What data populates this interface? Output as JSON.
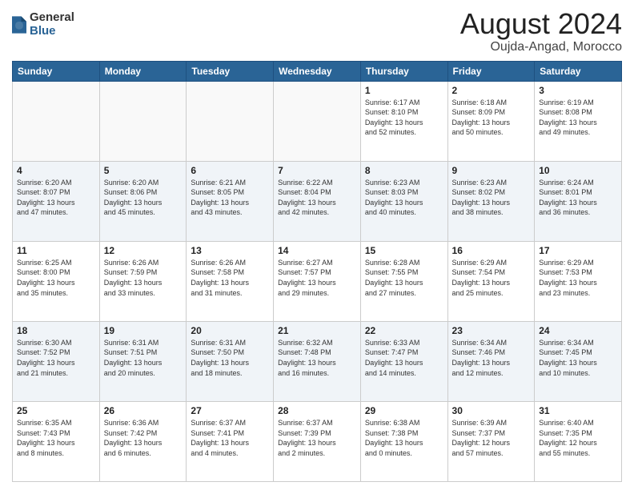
{
  "logo": {
    "general": "General",
    "blue": "Blue"
  },
  "title": "August 2024",
  "location": "Oujda-Angad, Morocco",
  "weekdays": [
    "Sunday",
    "Monday",
    "Tuesday",
    "Wednesday",
    "Thursday",
    "Friday",
    "Saturday"
  ],
  "weeks": [
    [
      {
        "day": "",
        "detail": ""
      },
      {
        "day": "",
        "detail": ""
      },
      {
        "day": "",
        "detail": ""
      },
      {
        "day": "",
        "detail": ""
      },
      {
        "day": "1",
        "detail": "Sunrise: 6:17 AM\nSunset: 8:10 PM\nDaylight: 13 hours\nand 52 minutes."
      },
      {
        "day": "2",
        "detail": "Sunrise: 6:18 AM\nSunset: 8:09 PM\nDaylight: 13 hours\nand 50 minutes."
      },
      {
        "day": "3",
        "detail": "Sunrise: 6:19 AM\nSunset: 8:08 PM\nDaylight: 13 hours\nand 49 minutes."
      }
    ],
    [
      {
        "day": "4",
        "detail": "Sunrise: 6:20 AM\nSunset: 8:07 PM\nDaylight: 13 hours\nand 47 minutes."
      },
      {
        "day": "5",
        "detail": "Sunrise: 6:20 AM\nSunset: 8:06 PM\nDaylight: 13 hours\nand 45 minutes."
      },
      {
        "day": "6",
        "detail": "Sunrise: 6:21 AM\nSunset: 8:05 PM\nDaylight: 13 hours\nand 43 minutes."
      },
      {
        "day": "7",
        "detail": "Sunrise: 6:22 AM\nSunset: 8:04 PM\nDaylight: 13 hours\nand 42 minutes."
      },
      {
        "day": "8",
        "detail": "Sunrise: 6:23 AM\nSunset: 8:03 PM\nDaylight: 13 hours\nand 40 minutes."
      },
      {
        "day": "9",
        "detail": "Sunrise: 6:23 AM\nSunset: 8:02 PM\nDaylight: 13 hours\nand 38 minutes."
      },
      {
        "day": "10",
        "detail": "Sunrise: 6:24 AM\nSunset: 8:01 PM\nDaylight: 13 hours\nand 36 minutes."
      }
    ],
    [
      {
        "day": "11",
        "detail": "Sunrise: 6:25 AM\nSunset: 8:00 PM\nDaylight: 13 hours\nand 35 minutes."
      },
      {
        "day": "12",
        "detail": "Sunrise: 6:26 AM\nSunset: 7:59 PM\nDaylight: 13 hours\nand 33 minutes."
      },
      {
        "day": "13",
        "detail": "Sunrise: 6:26 AM\nSunset: 7:58 PM\nDaylight: 13 hours\nand 31 minutes."
      },
      {
        "day": "14",
        "detail": "Sunrise: 6:27 AM\nSunset: 7:57 PM\nDaylight: 13 hours\nand 29 minutes."
      },
      {
        "day": "15",
        "detail": "Sunrise: 6:28 AM\nSunset: 7:55 PM\nDaylight: 13 hours\nand 27 minutes."
      },
      {
        "day": "16",
        "detail": "Sunrise: 6:29 AM\nSunset: 7:54 PM\nDaylight: 13 hours\nand 25 minutes."
      },
      {
        "day": "17",
        "detail": "Sunrise: 6:29 AM\nSunset: 7:53 PM\nDaylight: 13 hours\nand 23 minutes."
      }
    ],
    [
      {
        "day": "18",
        "detail": "Sunrise: 6:30 AM\nSunset: 7:52 PM\nDaylight: 13 hours\nand 21 minutes."
      },
      {
        "day": "19",
        "detail": "Sunrise: 6:31 AM\nSunset: 7:51 PM\nDaylight: 13 hours\nand 20 minutes."
      },
      {
        "day": "20",
        "detail": "Sunrise: 6:31 AM\nSunset: 7:50 PM\nDaylight: 13 hours\nand 18 minutes."
      },
      {
        "day": "21",
        "detail": "Sunrise: 6:32 AM\nSunset: 7:48 PM\nDaylight: 13 hours\nand 16 minutes."
      },
      {
        "day": "22",
        "detail": "Sunrise: 6:33 AM\nSunset: 7:47 PM\nDaylight: 13 hours\nand 14 minutes."
      },
      {
        "day": "23",
        "detail": "Sunrise: 6:34 AM\nSunset: 7:46 PM\nDaylight: 13 hours\nand 12 minutes."
      },
      {
        "day": "24",
        "detail": "Sunrise: 6:34 AM\nSunset: 7:45 PM\nDaylight: 13 hours\nand 10 minutes."
      }
    ],
    [
      {
        "day": "25",
        "detail": "Sunrise: 6:35 AM\nSunset: 7:43 PM\nDaylight: 13 hours\nand 8 minutes."
      },
      {
        "day": "26",
        "detail": "Sunrise: 6:36 AM\nSunset: 7:42 PM\nDaylight: 13 hours\nand 6 minutes."
      },
      {
        "day": "27",
        "detail": "Sunrise: 6:37 AM\nSunset: 7:41 PM\nDaylight: 13 hours\nand 4 minutes."
      },
      {
        "day": "28",
        "detail": "Sunrise: 6:37 AM\nSunset: 7:39 PM\nDaylight: 13 hours\nand 2 minutes."
      },
      {
        "day": "29",
        "detail": "Sunrise: 6:38 AM\nSunset: 7:38 PM\nDaylight: 13 hours\nand 0 minutes."
      },
      {
        "day": "30",
        "detail": "Sunrise: 6:39 AM\nSunset: 7:37 PM\nDaylight: 12 hours\nand 57 minutes."
      },
      {
        "day": "31",
        "detail": "Sunrise: 6:40 AM\nSunset: 7:35 PM\nDaylight: 12 hours\nand 55 minutes."
      }
    ]
  ]
}
